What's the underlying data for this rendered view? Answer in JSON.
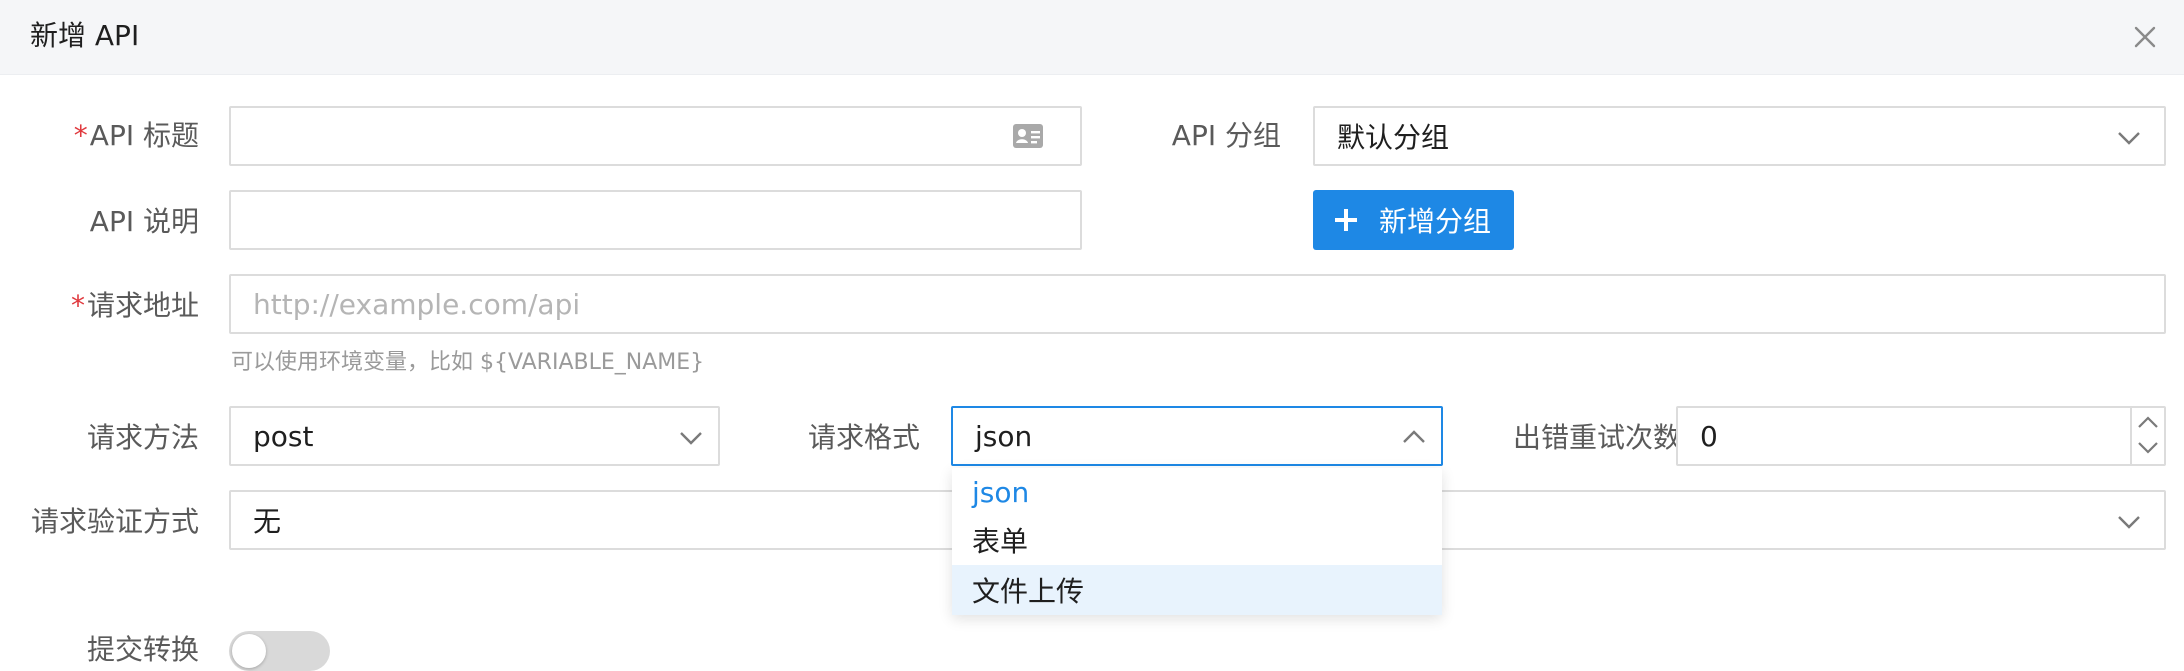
{
  "dialog": {
    "title": "新增 API"
  },
  "form": {
    "api_title": {
      "label": "API 标题",
      "required": true,
      "value": ""
    },
    "api_group": {
      "label": "API 分组",
      "value": "默认分组"
    },
    "api_desc": {
      "label": "API 说明",
      "value": ""
    },
    "add_group_button": {
      "label": "新增分组"
    },
    "request_url": {
      "label": "请求地址",
      "required": true,
      "placeholder": "http://example.com/api",
      "hint": "可以使用环境变量，比如 ${VARIABLE_NAME}"
    },
    "request_method": {
      "label": "请求方法",
      "value": "post"
    },
    "request_format": {
      "label": "请求格式",
      "value": "json",
      "options": [
        "json",
        "表单",
        "文件上传"
      ],
      "selected_index": 0,
      "hover_index": 2
    },
    "retry_count": {
      "label": "出错重试次数",
      "value": "0"
    },
    "auth_method": {
      "label": "请求验证方式",
      "value": "无"
    },
    "submit_convert": {
      "label": "提交转换",
      "enabled": false
    }
  },
  "colors": {
    "primary": "#1e88e5",
    "required": "#e0393e",
    "header_bg": "#f5f6f8",
    "hover_bg": "#e8f3fd"
  },
  "icons": {
    "close": "close-icon",
    "id_card": "id-card-icon",
    "chevron_down": "chevron-down-icon",
    "chevron_up": "chevron-up-icon",
    "plus": "plus-icon"
  }
}
